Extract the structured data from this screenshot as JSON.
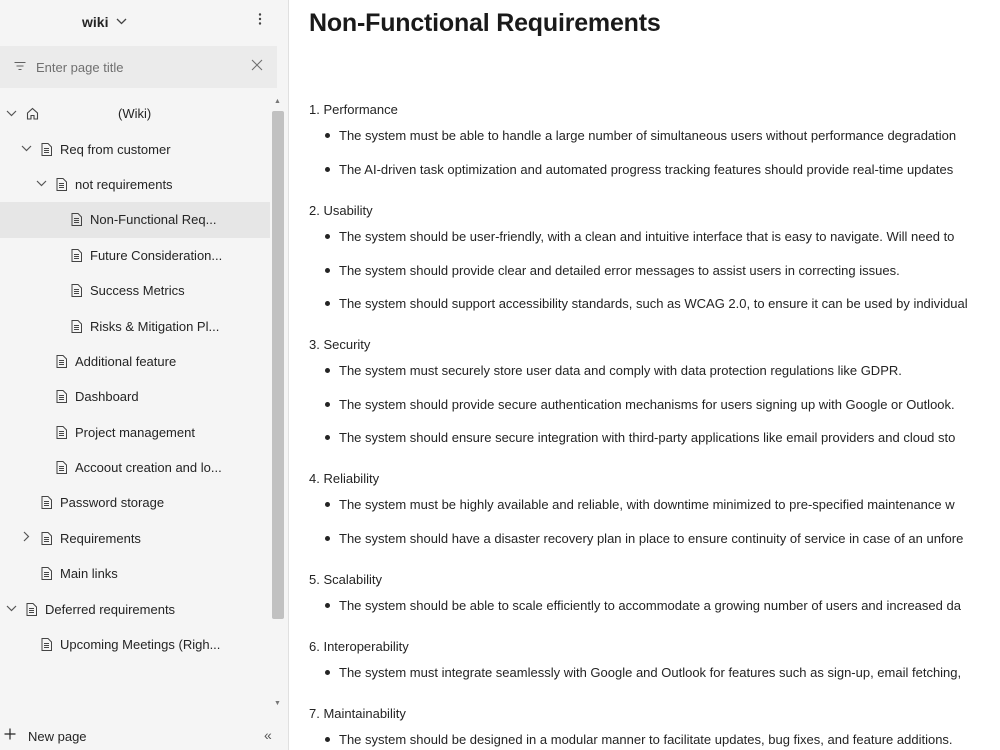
{
  "sidebar": {
    "wiki_name": "wiki",
    "filter_placeholder": "Enter page title",
    "tree": [
      {
        "label": "(Wiki)",
        "level": 0,
        "expanded": true,
        "home": true
      },
      {
        "label": "Req from customer",
        "level": 1,
        "expanded": true
      },
      {
        "label": "not requirements",
        "level": 2,
        "expanded": true
      },
      {
        "label": "Non-Functional Req...",
        "level": 3,
        "selected": true
      },
      {
        "label": "Future Consideration...",
        "level": 3
      },
      {
        "label": "Success Metrics",
        "level": 3
      },
      {
        "label": "Risks & Mitigation Pl...",
        "level": 3
      },
      {
        "label": "Additional feature",
        "level": 2
      },
      {
        "label": "Dashboard",
        "level": 2
      },
      {
        "label": "Project management",
        "level": 2
      },
      {
        "label": "Accoout creation and lo...",
        "level": 2
      },
      {
        "label": "Password storage",
        "level": 1
      },
      {
        "label": "Requirements",
        "level": 1,
        "collapsed": true
      },
      {
        "label": "Main links",
        "level": 1
      },
      {
        "label": "Deferred requirements",
        "level": 0,
        "expanded": true
      },
      {
        "label": "Upcoming Meetings (Righ...",
        "level": 1
      }
    ],
    "new_page_label": "New page"
  },
  "page": {
    "title": "Non-Functional Requirements",
    "sections": [
      {
        "heading": "1. Performance",
        "bullets": [
          "The system must be able to handle a large number of simultaneous users without performance degradation",
          "The AI-driven task optimization and automated progress tracking features should provide real-time updates"
        ]
      },
      {
        "heading": "2. Usability",
        "bullets": [
          "The system should be user-friendly, with a clean and intuitive interface that is easy to navigate. Will need to",
          "The system should provide clear and detailed error messages to assist users in correcting issues.",
          "The system should support accessibility standards, such as WCAG 2.0, to ensure it can be used by individual"
        ]
      },
      {
        "heading": "3. Security",
        "bullets": [
          "The system must securely store user data and comply with data protection regulations like GDPR.",
          "The system should provide secure authentication mechanisms for users signing up with Google or Outlook.",
          "The system should ensure secure integration with third-party applications like email providers and cloud sto"
        ]
      },
      {
        "heading": "4. Reliability",
        "bullets": [
          "The system must be highly available and reliable, with downtime minimized to pre-specified maintenance w",
          "The system should have a disaster recovery plan in place to ensure continuity of service in case of an unfore"
        ]
      },
      {
        "heading": "5. Scalability",
        "bullets": [
          "The system should be able to scale efficiently to accommodate a growing number of users and increased da"
        ]
      },
      {
        "heading": "6. Interoperability",
        "bullets": [
          "The system must integrate seamlessly with Google and Outlook for features such as sign-up, email fetching,"
        ]
      },
      {
        "heading": "7. Maintainability",
        "bullets": [
          "The system should be designed in a modular manner to facilitate updates, bug fixes, and feature additions."
        ]
      }
    ]
  },
  "colors": {
    "sidebar_bg": "#f5f5f5",
    "selected_row_bg": "#e6e6e6",
    "text": "#242424",
    "scroll_thumb": "#c1c1c1"
  },
  "icons": [
    "chevron-down-icon",
    "more-vertical-icon",
    "filter-icon",
    "close-icon",
    "home-icon",
    "page-icon",
    "chevron-right-icon",
    "plus-icon",
    "collapse-left-icon"
  ]
}
